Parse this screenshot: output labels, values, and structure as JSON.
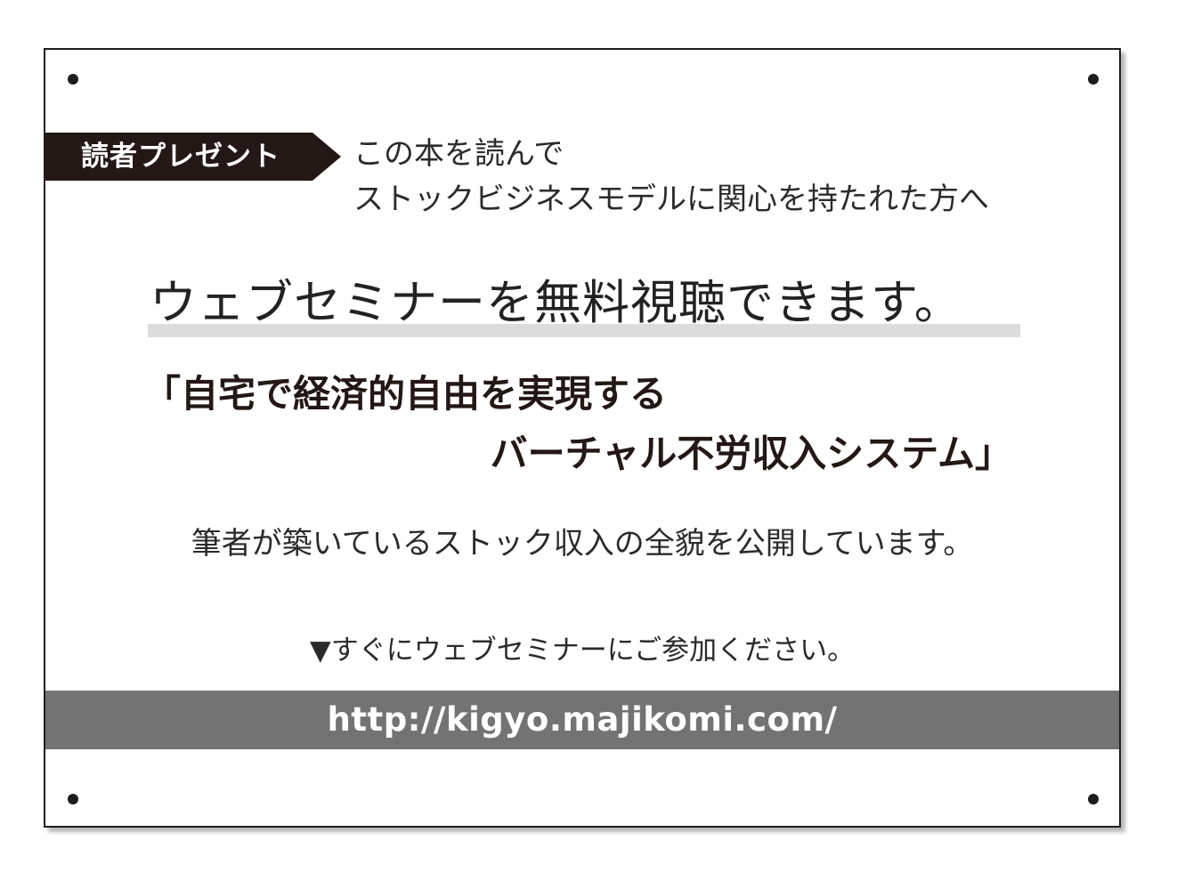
{
  "tag": {
    "label": "読者プレゼント"
  },
  "intro": {
    "line1": "この本を読んで",
    "line2": "ストックビジネスモデルに関心を持たれた方へ"
  },
  "headline": "ウェブセミナーを無料視聴できます。",
  "subtitle": {
    "line1": "「自宅で経済的自由を実現する",
    "line2": "バーチャル不労収入システム」"
  },
  "description": "筆者が築いているストック収入の全貌を公開しています。",
  "cta": "▼すぐにウェブセミナーにご参加ください。",
  "url": "http://kigyo.majikomi.com/",
  "colors": {
    "tag_background": "#231815",
    "url_bar_background": "#737373",
    "underline": "#dcdcdc"
  }
}
